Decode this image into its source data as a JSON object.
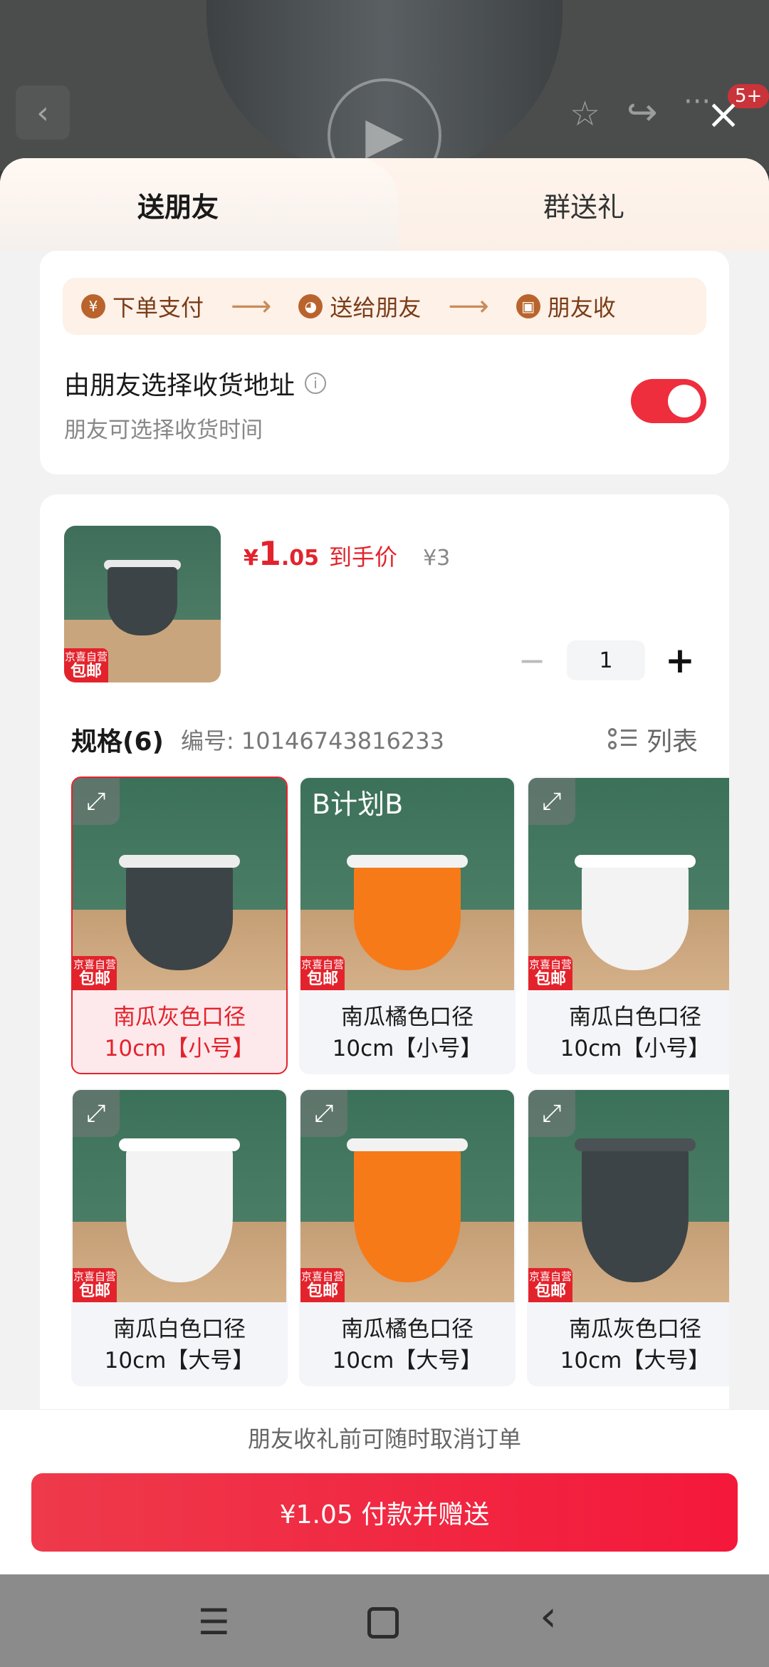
{
  "background": {
    "notification_count": "5+"
  },
  "tabs": {
    "send_friend": "送朋友",
    "group_gift": "群送礼"
  },
  "steps": [
    {
      "icon": "¥",
      "label": "下单支付"
    },
    {
      "icon": "◕",
      "label": "送给朋友"
    },
    {
      "icon": "▣",
      "label": "朋友收"
    }
  ],
  "address": {
    "title": "由朋友选择收货地址",
    "subtitle": "朋友可选择收货时间",
    "toggle_on": true
  },
  "product": {
    "badge_top": "京喜自营",
    "badge_bottom": "包邮",
    "price_symbol": "¥",
    "price_int": "1",
    "price_dec": ".05",
    "price_label": "到手价",
    "original_price": "¥3",
    "quantity": "1"
  },
  "specs": {
    "title": "规格(6)",
    "code": "编号: 10146743816233",
    "view_label": "列表",
    "plan_label": "B计划B",
    "options": [
      {
        "line1": "南瓜灰色口径",
        "line2": "10cm【小号】",
        "color": "#3d4447",
        "selected": true
      },
      {
        "line1": "南瓜橘色口径",
        "line2": "10cm【小号】",
        "color": "#f77a18",
        "selected": false
      },
      {
        "line1": "南瓜白色口径",
        "line2": "10cm【小号】",
        "color": "#f3f3f3",
        "selected": false
      },
      {
        "line1": "南瓜白色口径",
        "line2": "10cm【大号】",
        "color": "#f3f3f3",
        "selected": false
      },
      {
        "line1": "南瓜橘色口径",
        "line2": "10cm【大号】",
        "color": "#f77a18",
        "selected": false
      },
      {
        "line1": "南瓜灰色口径",
        "line2": "10cm【大号】",
        "color": "#3d4447",
        "selected": false
      }
    ]
  },
  "footer": {
    "notice": "朋友收礼前可随时取消订单",
    "pay_button": "¥1.05 付款并赠送"
  },
  "colors": {
    "accent": "#e3232c",
    "pay_button": "#f4183a",
    "step_text": "#7a3c17"
  }
}
